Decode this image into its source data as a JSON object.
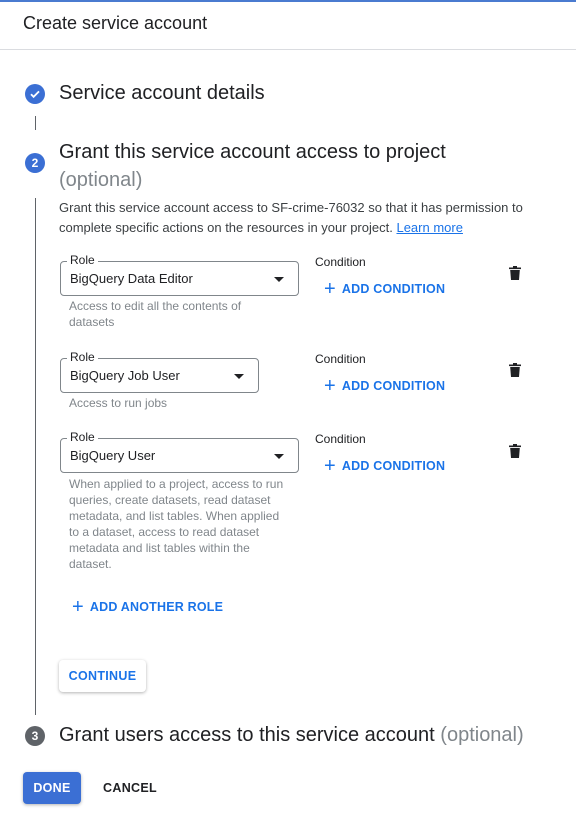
{
  "header": {
    "title": "Create service account"
  },
  "steps": [
    {
      "number": "1",
      "title": "Service account details",
      "status": "complete"
    },
    {
      "number": "2",
      "title": "Grant this service account access to project",
      "optional": "(optional)",
      "status": "active",
      "description": "Grant this service account access to SF-crime-76032 so that it has permission to complete specific actions on the resources in your project.",
      "learn_more": "Learn more"
    },
    {
      "number": "3",
      "title": "Grant users access to this service account",
      "optional": "(optional)",
      "status": "pending"
    }
  ],
  "roles": [
    {
      "label": "Role",
      "value": "BigQuery Data Editor",
      "help": "Access to edit all the contents of datasets",
      "condition_label": "Condition",
      "add_condition": "ADD CONDITION"
    },
    {
      "label": "Role",
      "value": "BigQuery Job User",
      "help": "Access to run jobs",
      "condition_label": "Condition",
      "add_condition": "ADD CONDITION"
    },
    {
      "label": "Role",
      "value": "BigQuery User",
      "help": "When applied to a project, access to run queries, create datasets, read dataset metadata, and list tables. When applied to a dataset, access to read dataset metadata and list tables within the dataset.",
      "condition_label": "Condition",
      "add_condition": "ADD CONDITION"
    }
  ],
  "add_another_role": "ADD ANOTHER ROLE",
  "continue_label": "CONTINUE",
  "footer": {
    "done": "DONE",
    "cancel": "CANCEL"
  },
  "colors": {
    "accent": "#1a73e8",
    "step_active": "#3b6fd4",
    "step_pending": "#5f6368"
  }
}
